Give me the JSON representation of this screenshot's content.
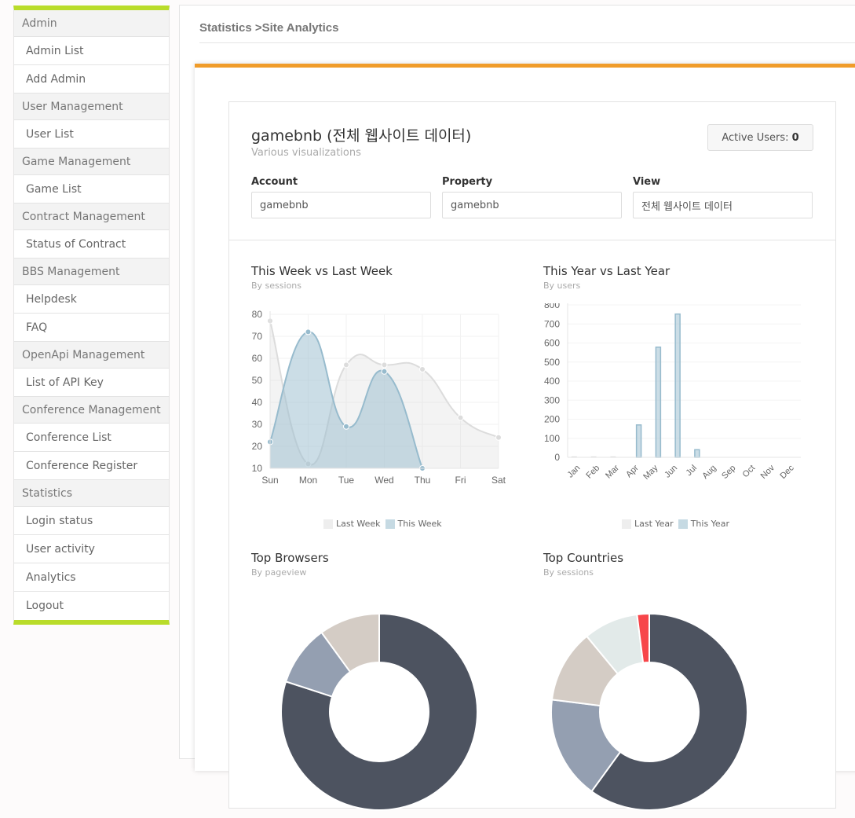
{
  "sidebar": {
    "sections": [
      {
        "group": "Admin",
        "items": [
          "Admin List",
          "Add Admin"
        ]
      },
      {
        "group": "User Management",
        "items": [
          "User List"
        ]
      },
      {
        "group": "Game Management",
        "items": [
          "Game List"
        ]
      },
      {
        "group": "Contract Management",
        "items": [
          "Status of Contract"
        ]
      },
      {
        "group": "BBS Management",
        "items": [
          "Helpdesk",
          "FAQ"
        ]
      },
      {
        "group": "OpenApi Management",
        "items": [
          "List of API Key"
        ]
      },
      {
        "group": "Conference Management",
        "items": [
          "Conference List",
          "Conference Register"
        ]
      },
      {
        "group": "Statistics",
        "items": [
          "Login status",
          "User activity",
          "Analytics",
          "Logout"
        ]
      }
    ]
  },
  "header": {
    "breadcrumb": "Statistics >Site Analytics"
  },
  "card": {
    "title": "gamebnb (전체 웹사이트 데이터)",
    "subtitle": "Various visualizations",
    "active_users_label": "Active Users: ",
    "active_users_value": "0",
    "fields": {
      "account": {
        "label": "Account",
        "value": "gamebnb"
      },
      "property": {
        "label": "Property",
        "value": "gamebnb"
      },
      "view": {
        "label": "View",
        "value": "전체 웹사이트 데이터"
      }
    }
  },
  "colors": {
    "accent_orange": "#f09c2a",
    "sidebar_green": "#b9dc2a",
    "this_series": "#97bbcd",
    "last_series": "#dcdcdc",
    "donut": [
      "#4d5360",
      "#949fb1",
      "#d4ccc5",
      "#e2eae9",
      "#f7464a"
    ]
  },
  "chart_data": [
    {
      "type": "line",
      "title": "This Week vs Last Week",
      "subtitle": "By sessions",
      "categories": [
        "Sun",
        "Mon",
        "Tue",
        "Wed",
        "Thu",
        "Fri",
        "Sat"
      ],
      "ylim": [
        10,
        80
      ],
      "yticks": [
        10,
        20,
        30,
        40,
        50,
        60,
        70,
        80
      ],
      "series": [
        {
          "name": "Last Week",
          "values": [
            77,
            12,
            57,
            57,
            55,
            33,
            24
          ]
        },
        {
          "name": "This Week",
          "values": [
            22,
            72,
            29,
            54,
            10
          ]
        }
      ],
      "legend": "bottom"
    },
    {
      "type": "bar",
      "title": "This Year vs Last Year",
      "subtitle": "By users",
      "categories": [
        "Jan",
        "Feb",
        "Mar",
        "Apr",
        "May",
        "Jun",
        "Jul",
        "Aug",
        "Sep",
        "Oct",
        "Nov",
        "Dec"
      ],
      "ylim": [
        0,
        800
      ],
      "yticks": [
        0,
        100,
        200,
        300,
        400,
        500,
        600,
        700,
        800
      ],
      "series": [
        {
          "name": "Last Year",
          "values": [
            3,
            3,
            3,
            0,
            0,
            0,
            0,
            0,
            0,
            0,
            0,
            0
          ]
        },
        {
          "name": "This Year",
          "values": [
            0,
            0,
            0,
            170,
            578,
            752,
            40,
            0,
            0,
            0,
            0,
            0
          ]
        }
      ],
      "legend": "bottom"
    },
    {
      "type": "pie",
      "title": "Top Browsers",
      "subtitle": "By pageview",
      "values": [
        80,
        10,
        10
      ]
    },
    {
      "type": "pie",
      "title": "Top Countries",
      "subtitle": "By sessions",
      "values": [
        60,
        17,
        12,
        9,
        2
      ]
    }
  ]
}
